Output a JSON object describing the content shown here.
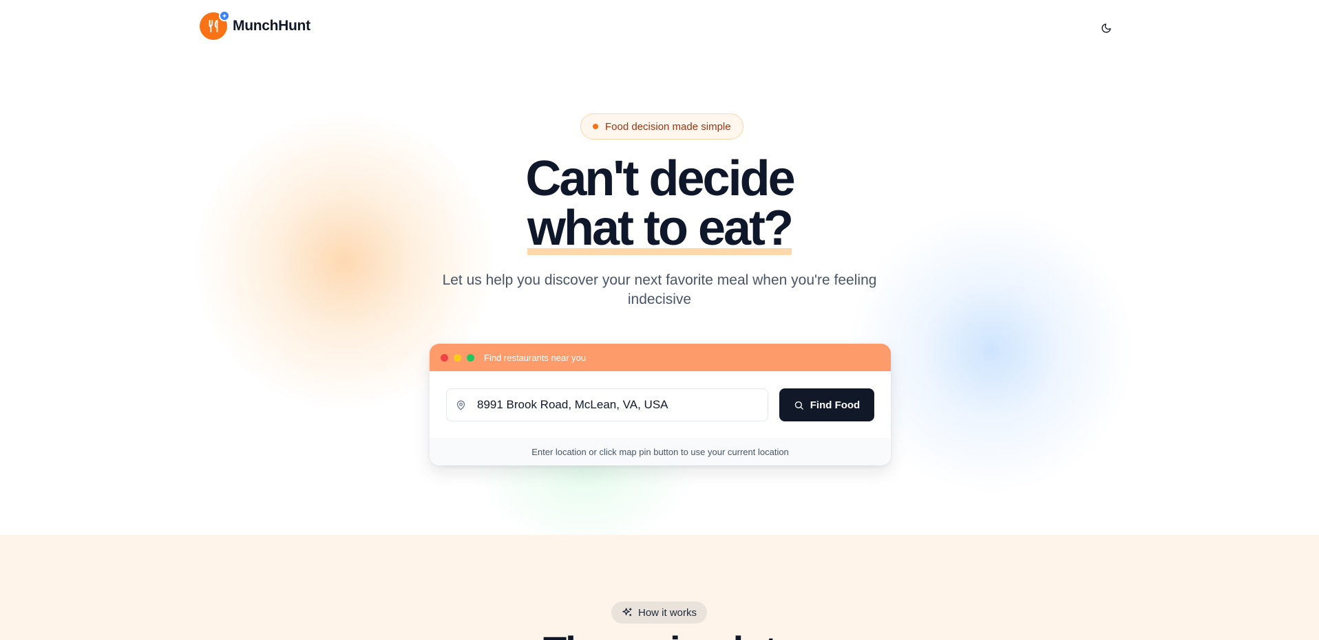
{
  "header": {
    "brand": "MunchHunt",
    "theme_toggle_icon": "moon-icon"
  },
  "hero": {
    "pill_text": "Food decision made simple",
    "headline_line1": "Can't decide",
    "headline_line2": "what to eat?",
    "subtitle": "Let us help you discover your next favorite meal when you're feeling indecisive"
  },
  "search_card": {
    "bar_title": "Find restaurants near you",
    "location_value": "8991 Brook Road, McLean, VA, USA",
    "find_button_label": "Find Food",
    "helper_text": "Enter location or click map pin button to use your current location"
  },
  "how_it_works": {
    "pill_label": "How it works",
    "title": "The main plot"
  },
  "colors": {
    "brand_orange": "#f97316",
    "accent_blue": "#3b82f6",
    "card_bar": "#fe9b6a",
    "button_dark": "#111827",
    "section_bg": "#fef4ea"
  }
}
